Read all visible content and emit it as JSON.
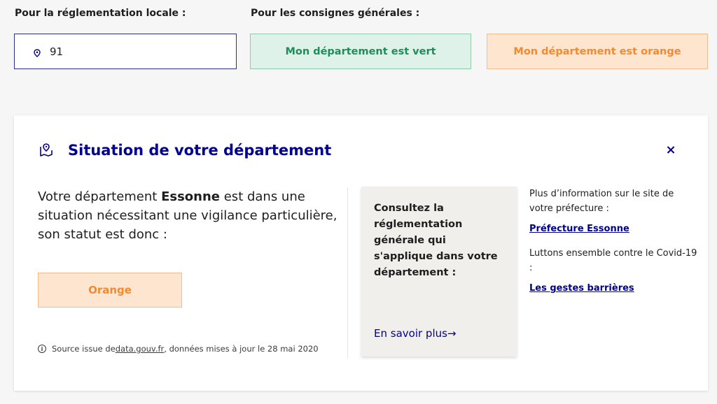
{
  "filters": {
    "local_label": "Pour la réglementation locale :",
    "general_label": "Pour les consignes générales :",
    "search_value": "91",
    "green_button": "Mon département est vert",
    "orange_button": "Mon département est orange"
  },
  "card": {
    "title": "Situation de votre département",
    "close": "×",
    "desc_before": "Votre département ",
    "department": "Essonne",
    "desc_after": " est dans une situation nécessitant une vigilance particulière, son statut est donc :",
    "status": "Orange",
    "source_before": "Source issue de ",
    "source_link": "data.gouv.fr",
    "source_after": ", données mises à jour le 28 mai 2020",
    "consult_text": "Consultez la réglementation générale qui s'applique dans votre département :",
    "learn_more": "En savoir plus→",
    "prefecture_info": "Plus d’information sur le site de votre préfecture :",
    "prefecture_link": "Préfecture Essonne",
    "covid_info": "Luttons ensemble contre le Covid-19 :",
    "gestures_link": "Les gestes barrières"
  },
  "colors": {
    "primary": "#000091",
    "green": "#1f8d58",
    "orange": "#f28a30"
  }
}
